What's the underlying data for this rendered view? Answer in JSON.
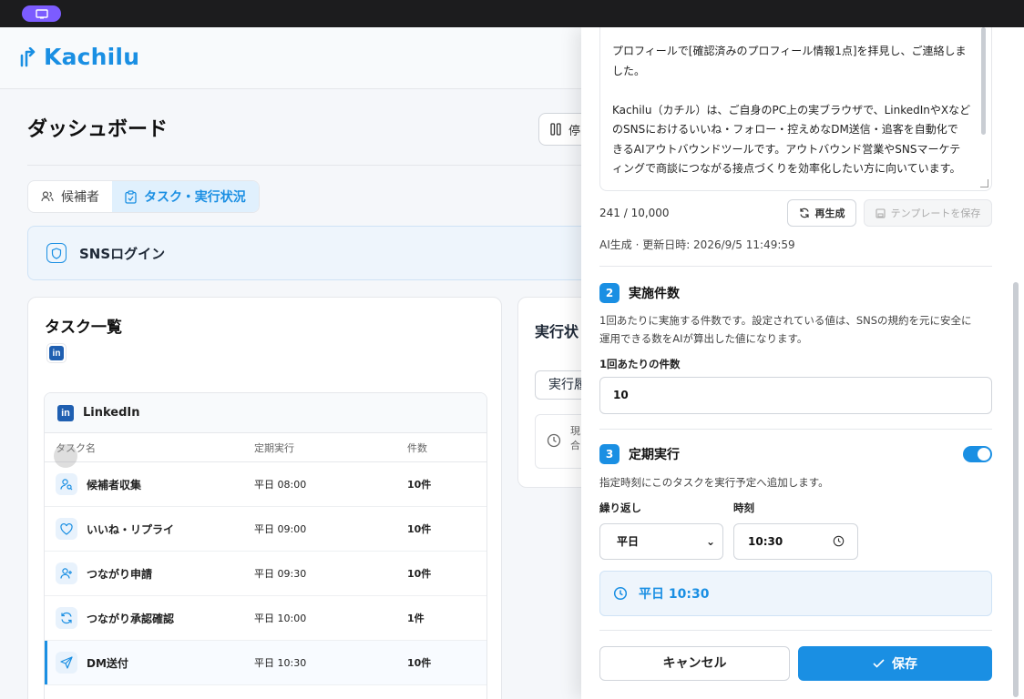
{
  "app": {
    "name": "Kachilu"
  },
  "page": {
    "title": "ダッシュボード",
    "header_button_partial": "停"
  },
  "tabs": [
    {
      "label": "候補者",
      "active": false
    },
    {
      "label": "タスク・実行状況",
      "active": true
    }
  ],
  "sns_login": {
    "label": "SNSログイン"
  },
  "task_list": {
    "title": "タスク一覧",
    "platform": "LinkedIn",
    "columns": [
      "タスク名",
      "定期実行",
      "件数"
    ],
    "rows": [
      {
        "name": "候補者収集",
        "schedule": "平日 08:00",
        "count": "10件",
        "icon": "user-search-icon"
      },
      {
        "name": "いいね・リプライ",
        "schedule": "平日 09:00",
        "count": "10件",
        "icon": "heart-icon"
      },
      {
        "name": "つながり申請",
        "schedule": "平日 09:30",
        "count": "10件",
        "icon": "user-plus-icon"
      },
      {
        "name": "つながり承認確認",
        "schedule": "平日 10:00",
        "count": "1件",
        "icon": "refresh-icon"
      },
      {
        "name": "DM送付",
        "schedule": "平日 10:30",
        "count": "10件",
        "icon": "send-icon",
        "active": true
      }
    ]
  },
  "execution": {
    "title_partial": "実行状",
    "button_partial": "実行履",
    "note_partial_1": "現",
    "note_partial_2": "合"
  },
  "drawer": {
    "message_lines": [
      "プロフィールで[確認済みのプロフィール情報1点]を拝見し、ご連絡しま",
      "した。",
      "",
      "Kachilu（カチル）は、ご自身のPC上の実ブラウザで、LinkedInやXなど",
      "のSNSにおけるいいね・フォロー・控えめなDM送信・追客を自動化で",
      "きるAIアウトバウンドツールです。アウトバウンド営業やSNSマーケテ",
      "ィングで商談につながる接点づくりを効率化したい方に向いています。"
    ],
    "char_count": "241 / 10,000",
    "regenerate_label": "再生成",
    "save_template_label": "テンプレートを保存",
    "meta": "AI生成 · 更新日時: 2026/9/5 11:49:59",
    "section2": {
      "number": "2",
      "title": "実施件数",
      "desc_lines": [
        "1回あたりに実施する件数です。設定されている値は、SNSの規約を元に安全に",
        "運用できる数をAIが算出した値になります。"
      ],
      "field_label": "1回あたりの件数",
      "field_value": "10"
    },
    "section3": {
      "number": "3",
      "title": "定期実行",
      "enabled": true,
      "desc": "指定時刻にこのタスクを実行予定へ追加します。",
      "repeat_label": "繰り返し",
      "repeat_value": "平日",
      "time_label": "時刻",
      "time_value": "10:30",
      "summary": "平日 10:30"
    },
    "cancel_label": "キャンセル",
    "save_label": "保存"
  },
  "colors": {
    "accent": "#1a8fe3",
    "brand_purple": "#7c5cff"
  }
}
